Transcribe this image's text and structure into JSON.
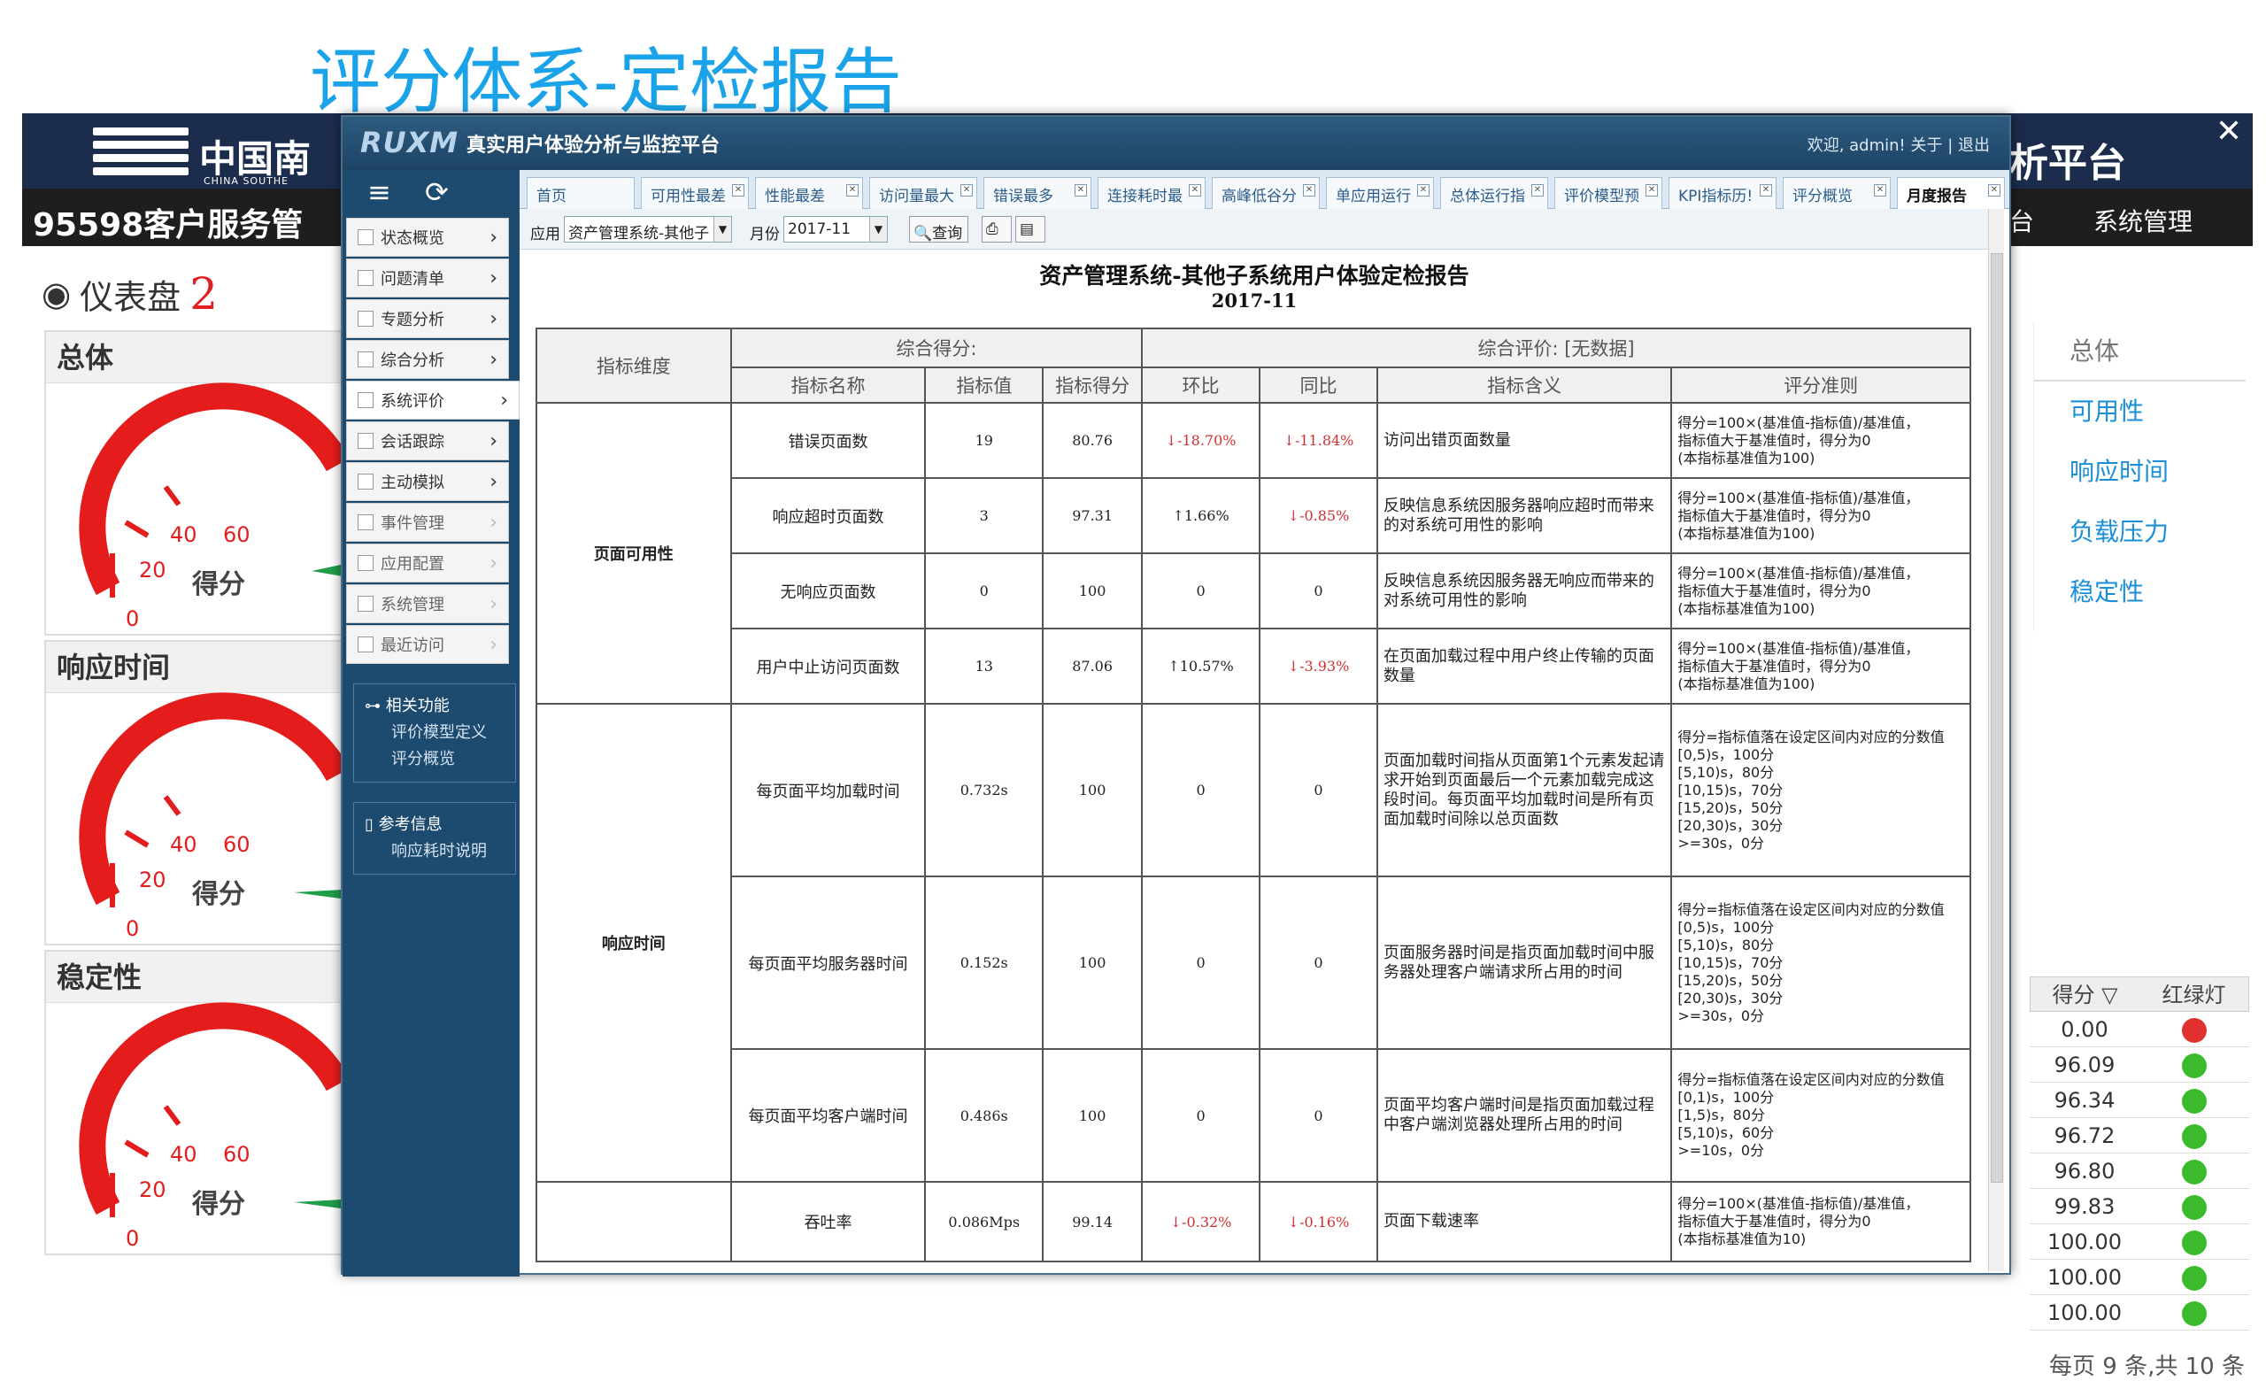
{
  "slide_title": "评分体系-定检报告",
  "bg": {
    "logo_cn": "中国南",
    "logo_en": "CHINA SOUTHE",
    "right_title": "析平台",
    "hotline": "95598客户服务管",
    "nav_partial": "台",
    "nav_sys": "系统管理",
    "close": "✕",
    "dash_title": "仪表盘",
    "dash_count": "2",
    "panels": [
      {
        "title": "总体",
        "gauge_label": "得分",
        "ticks": [
          "0",
          "20",
          "40",
          "60"
        ]
      },
      {
        "title": "响应时间",
        "gauge_label": "得分",
        "ticks": [
          "0",
          "20",
          "40",
          "60"
        ]
      },
      {
        "title": "稳定性",
        "gauge_label": "得分",
        "ticks": [
          "0",
          "20",
          "40",
          "60"
        ]
      }
    ],
    "right_menu": [
      "总体",
      "可用性",
      "响应时间",
      "负载压力",
      "稳定性"
    ],
    "score_header": [
      "得分 ▽",
      "红绿灯"
    ],
    "scores": [
      {
        "value": "0.00",
        "color": "#e03030"
      },
      {
        "value": "96.09",
        "color": "#3bbb2c"
      },
      {
        "value": "96.34",
        "color": "#3bbb2c"
      },
      {
        "value": "96.72",
        "color": "#3bbb2c"
      },
      {
        "value": "96.80",
        "color": "#3bbb2c"
      },
      {
        "value": "99.83",
        "color": "#3bbb2c"
      },
      {
        "value": "100.00",
        "color": "#3bbb2c"
      },
      {
        "value": "100.00",
        "color": "#3bbb2c"
      },
      {
        "value": "100.00",
        "color": "#3bbb2c"
      }
    ],
    "pager": "每页 9 条,共 10 条"
  },
  "win": {
    "brand": "RUXM",
    "subtitle": "真实用户体验分析与监控平台",
    "links": "欢迎, admin!   关于  |  退出",
    "tools": "≡ ⟳",
    "menu": [
      {
        "label": "状态概览",
        "gray": false
      },
      {
        "label": "问题清单",
        "gray": false
      },
      {
        "label": "专题分析",
        "gray": false
      },
      {
        "label": "综合分析",
        "gray": false
      },
      {
        "label": "系统评价",
        "gray": false
      },
      {
        "label": "会话跟踪",
        "gray": false
      },
      {
        "label": "主动模拟",
        "gray": false
      },
      {
        "label": "事件管理",
        "gray": true
      },
      {
        "label": "应用配置",
        "gray": true
      },
      {
        "label": "系统管理",
        "gray": true
      },
      {
        "label": "最近访问",
        "gray": true
      }
    ],
    "related_title": "⊶ 相关功能",
    "related_items": [
      "评价模型定义",
      "评分概览"
    ],
    "ref_title": "▯ 参考信息",
    "ref_items": [
      "响应耗时说明"
    ],
    "tabs": [
      "首页",
      "可用性最差",
      "性能最差",
      "访问量最大",
      "错误最多",
      "连接耗时最",
      "高峰低谷分",
      "单应用运行",
      "总体运行指",
      "评价模型预",
      "KPI指标历!",
      "评分概览",
      "月度报告"
    ],
    "toolbar": {
      "app_label": "应用",
      "app_value": "资产管理系统-其他子",
      "month_label": "月份",
      "month_value": "2017-11",
      "query": "查询"
    },
    "report_title": "资产管理系统-其他子系统用户体验定检报告",
    "report_month": "2017-11",
    "table": {
      "dim_header": "指标维度",
      "overall_score": "综合得分:",
      "overall_eval": "综合评价: [无数据]",
      "cols": [
        "指标名称",
        "指标值",
        "指标得分",
        "环比",
        "同比",
        "指标含义",
        "评分准则"
      ],
      "groups": [
        {
          "name": "页面可用性",
          "rows": [
            {
              "name": "错误页面数",
              "value": "19",
              "score": "80.76",
              "mom": "↓-18.70%",
              "mom_red": true,
              "yoy": "↓-11.84%",
              "yoy_red": true,
              "meaning": "访问出错页面数量",
              "rule": "得分=100×(基准值-指标值)/基准值，\n指标值大于基准值时，得分为0\n(本指标基准值为100)"
            },
            {
              "name": "响应超时页面数",
              "value": "3",
              "score": "97.31",
              "mom": "↑1.66%",
              "mom_red": false,
              "yoy": "↓-0.85%",
              "yoy_red": true,
              "meaning": "反映信息系统因服务器响应超时而带来的对系统可用性的影响",
              "rule": "得分=100×(基准值-指标值)/基准值，\n指标值大于基准值时，得分为0\n(本指标基准值为100)"
            },
            {
              "name": "无响应页面数",
              "value": "0",
              "score": "100",
              "mom": "0",
              "mom_red": false,
              "yoy": "0",
              "yoy_red": false,
              "meaning": "反映信息系统因服务器无响应而带来的对系统可用性的影响",
              "rule": "得分=100×(基准值-指标值)/基准值，\n指标值大于基准值时，得分为0\n(本指标基准值为100)"
            },
            {
              "name": "用户中止访问页面数",
              "value": "13",
              "score": "87.06",
              "mom": "↑10.57%",
              "mom_red": false,
              "yoy": "↓-3.93%",
              "yoy_red": true,
              "meaning": "在页面加载过程中用户终止传输的页面数量",
              "rule": "得分=100×(基准值-指标值)/基准值，\n指标值大于基准值时，得分为0\n(本指标基准值为100)"
            }
          ]
        },
        {
          "name": "响应时间",
          "rows": [
            {
              "name": "每页面平均加载时间",
              "value": "0.732s",
              "score": "100",
              "mom": "0",
              "mom_red": false,
              "yoy": "0",
              "yoy_red": false,
              "meaning": "页面加载时间指从页面第1个元素发起请求开始到页面最后一个元素加载完成这段时间。每页面平均加载时间是所有页面加载时间除以总页面数",
              "rule": "得分=指标值落在设定区间内对应的分数值\n[0,5)s，100分\n[5,10)s，80分\n[10,15)s，70分\n[15,20)s，50分\n[20,30)s，30分\n>=30s，0分"
            },
            {
              "name": "每页面平均服务器时间",
              "value": "0.152s",
              "score": "100",
              "mom": "0",
              "mom_red": false,
              "yoy": "0",
              "yoy_red": false,
              "meaning": "页面服务器时间是指页面加载时间中服务器处理客户端请求所占用的时间",
              "rule": "得分=指标值落在设定区间内对应的分数值\n[0,5)s，100分\n[5,10)s，80分\n[10,15)s，70分\n[15,20)s，50分\n[20,30)s，30分\n>=30s，0分"
            },
            {
              "name": "每页面平均客户端时间",
              "value": "0.486s",
              "score": "100",
              "mom": "0",
              "mom_red": false,
              "yoy": "0",
              "yoy_red": false,
              "meaning": "页面平均客户端时间是指页面加载过程中客户端浏览器处理所占用的时间",
              "rule": "得分=指标值落在设定区间内对应的分数值\n[0,1)s，100分\n[1,5)s，80分\n[5,10)s，60分\n>=10s，0分"
            }
          ]
        },
        {
          "name": "",
          "rows": [
            {
              "name": "吞吐率",
              "value": "0.086Mps",
              "score": "99.14",
              "mom": "↓-0.32%",
              "mom_red": true,
              "yoy": "↓-0.16%",
              "yoy_red": true,
              "meaning": "页面下载速率",
              "rule": "得分=100×(基准值-指标值)/基准值，\n指标值大于基准值时，得分为0\n(本指标基准值为10)"
            }
          ]
        }
      ]
    }
  }
}
